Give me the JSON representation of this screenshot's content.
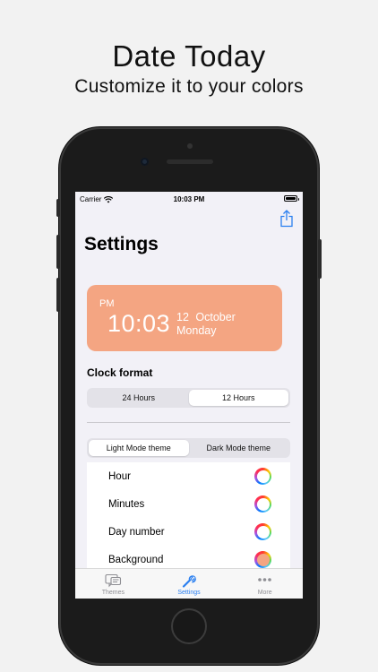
{
  "headline": "Date Today",
  "subline": "Customize it to your colors",
  "status_bar": {
    "carrier": "Carrier",
    "time": "10:03 PM"
  },
  "screen": {
    "title": "Settings",
    "clock_preview": {
      "ampm": "PM",
      "time": "10:03",
      "date": "12 October",
      "weekday": "Monday",
      "background_color": "#f4a582"
    },
    "clock_format": {
      "label": "Clock format",
      "options": [
        "24 Hours",
        "12 Hours"
      ],
      "selected": "12 Hours"
    },
    "theme_mode": {
      "options": [
        "Light Mode theme",
        "Dark Mode theme"
      ],
      "selected": "Light Mode theme"
    },
    "color_settings": [
      {
        "label": "Hour",
        "swatch": "#ffffff"
      },
      {
        "label": "Minutes",
        "swatch": "#ffffff"
      },
      {
        "label": "Day number",
        "swatch": "#ffffff"
      },
      {
        "label": "Background",
        "swatch": "#f4a582"
      }
    ]
  },
  "tabbar": {
    "items": [
      {
        "label": "Themes",
        "icon": "themes-icon"
      },
      {
        "label": "Settings",
        "icon": "wrench-icon"
      },
      {
        "label": "More",
        "icon": "more-icon"
      }
    ],
    "selected": "Settings",
    "accent_color": "#2a7ff0"
  }
}
